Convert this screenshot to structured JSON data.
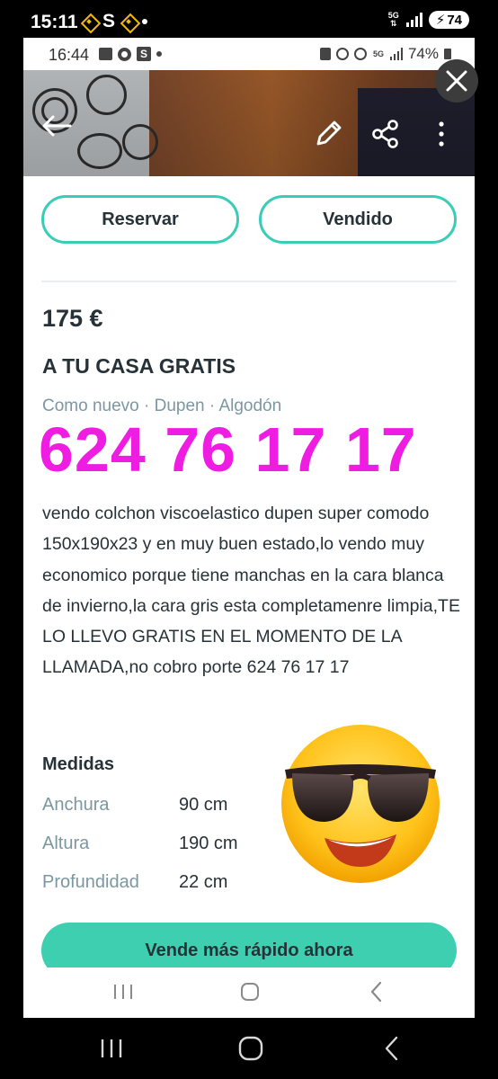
{
  "outer_status": {
    "time": "15:11",
    "s_letter": "S",
    "net": "5G",
    "battery": "74"
  },
  "inner_status": {
    "time": "16:44",
    "s_letter": "S",
    "net": "5G",
    "battery": "74%"
  },
  "actions": {
    "reserve_label": "Reservar",
    "sold_label": "Vendido"
  },
  "listing": {
    "price": "175 €",
    "title": "A TU CASA GRATIS",
    "subtitle": "Como nuevo · Dupen · Algodón",
    "phone_overlay": "624 76 17 17",
    "description": "vendo colchon viscoelastico dupen super comodo 150x190x23 y en muy buen estado,lo vendo muy economico porque tiene manchas en la cara blanca de invierno,la cara gris esta completamenre limpia,TE LO LLEVO GRATIS EN EL MOMENTO DE LA LLAMADA,no cobro porte 624 76 17 17"
  },
  "measures": {
    "heading": "Medidas",
    "rows": [
      {
        "label": "Anchura",
        "value": "90 cm"
      },
      {
        "label": "Altura",
        "value": "190 cm"
      },
      {
        "label": "Profundidad",
        "value": "22 cm"
      }
    ]
  },
  "cta": {
    "label": "Vende más rápido ahora"
  },
  "colors": {
    "accent": "#3ecfb1",
    "outline": "#39cdb7",
    "text": "#263238",
    "muted": "#7b97a2",
    "overlay": "#ee1de1"
  },
  "icons": [
    "back-arrow-icon",
    "pencil-icon",
    "share-icon",
    "more-vert-icon",
    "close-icon",
    "sunglasses-emoji",
    "recents-icon",
    "home-icon",
    "back-icon"
  ]
}
